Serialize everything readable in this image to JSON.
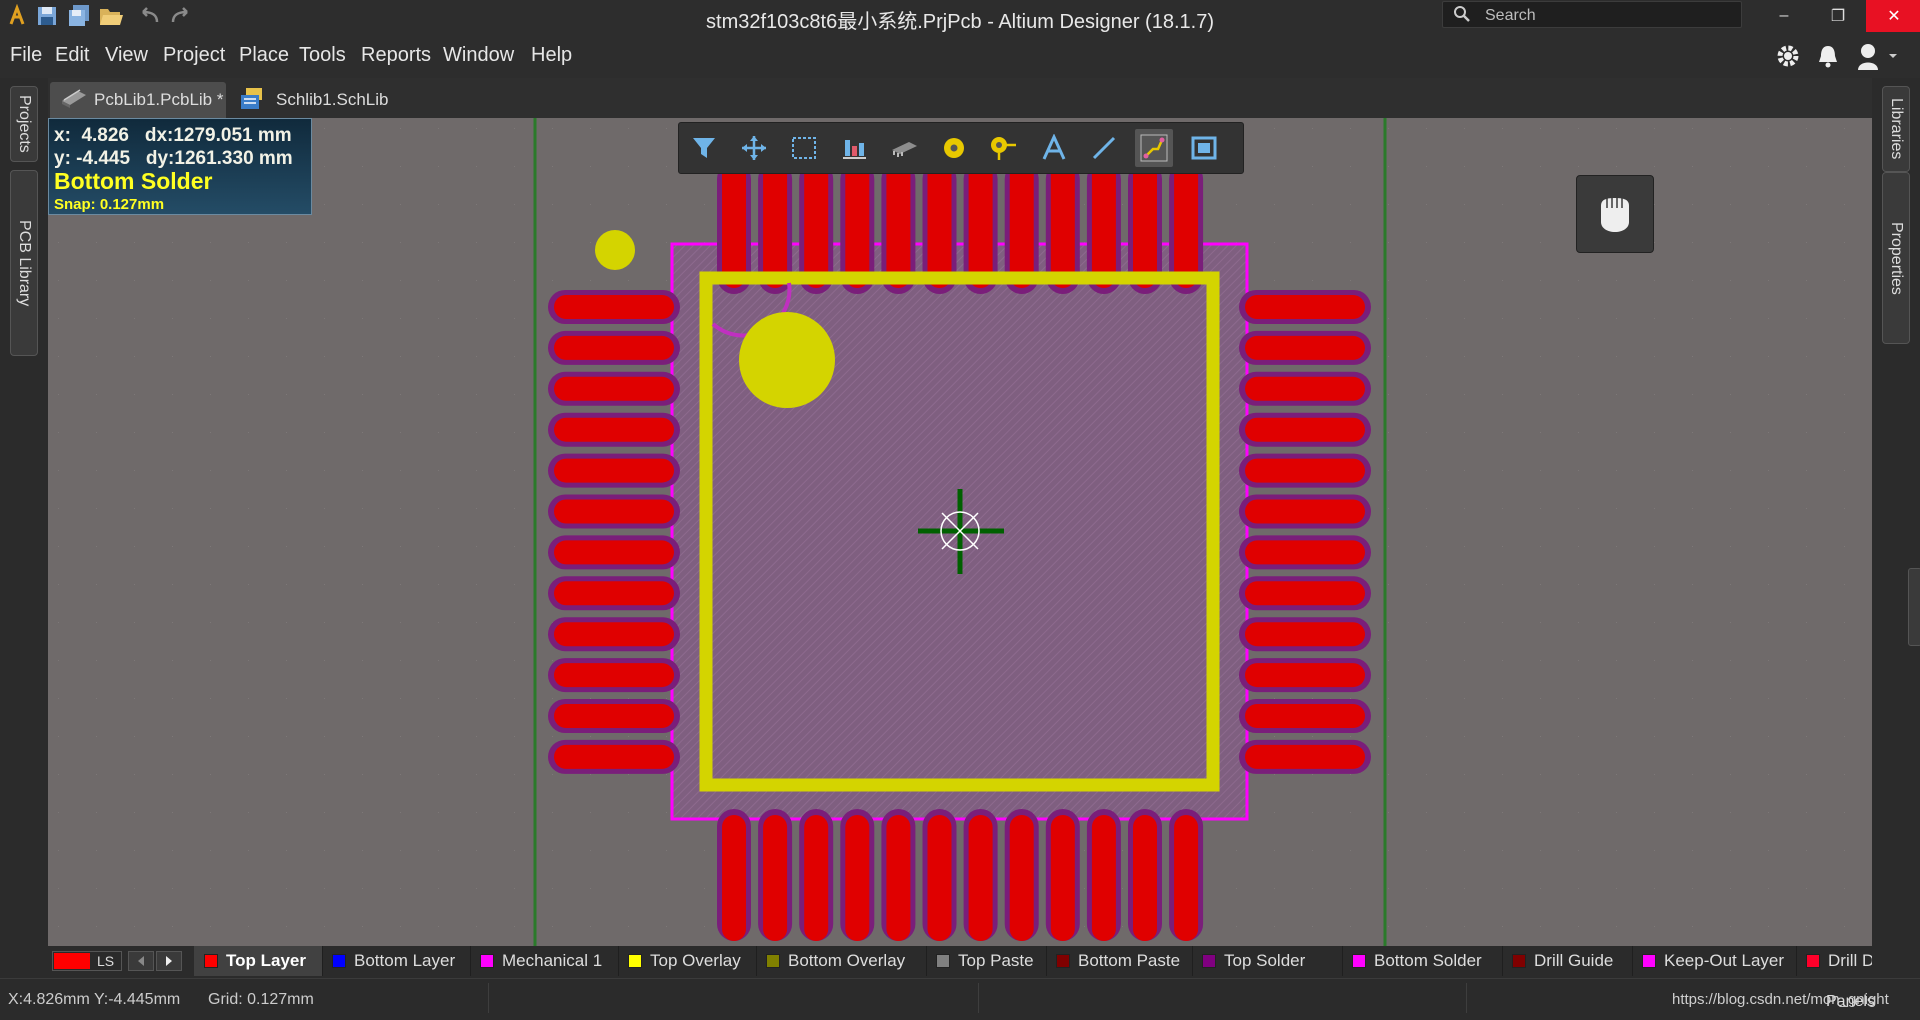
{
  "window": {
    "title": "stm32f103c8t6最小系统.PrjPcb - Altium Designer (18.1.7)",
    "search_placeholder": "Search",
    "min_glyph": "–",
    "restore_glyph": "❐",
    "close_glyph": "✕"
  },
  "menu": {
    "items": [
      "File",
      "Edit",
      "View",
      "Project",
      "Place",
      "Tools",
      "Reports",
      "Window",
      "Help"
    ]
  },
  "tabs": {
    "items": [
      {
        "label": "PcbLib1.PcbLib *",
        "active": true
      },
      {
        "label": "Schlib1.SchLib",
        "active": false
      }
    ]
  },
  "left_panels": [
    "Projects",
    "PCB Library"
  ],
  "right_panels": [
    "Libraries",
    "Properties"
  ],
  "hud": {
    "x_line": "x:  4.826   dx:1279.051 mm",
    "y_line": "y: -4.445   dy:1261.330 mm",
    "layer": "Bottom Solder",
    "snap": "Snap: 0.127mm"
  },
  "placement_toolbar": [
    "filter-icon",
    "move-icon",
    "select-rect-icon",
    "align-icon",
    "component-icon",
    "pad-icon",
    "via-icon",
    "string-icon",
    "line-icon",
    "route-icon",
    "region-icon"
  ],
  "layer_bar": {
    "ls_label": "LS",
    "current_color": "#ff0000",
    "layers": [
      {
        "name": "Top Layer",
        "color": "#ff0000",
        "active": true
      },
      {
        "name": "Bottom Layer",
        "color": "#0000ff",
        "active": false
      },
      {
        "name": "Mechanical 1",
        "color": "#ff00ff",
        "active": false
      },
      {
        "name": "Top Overlay",
        "color": "#ffff00",
        "active": false
      },
      {
        "name": "Bottom Overlay",
        "color": "#808000",
        "active": false
      },
      {
        "name": "Top Paste",
        "color": "#808080",
        "active": false
      },
      {
        "name": "Bottom Paste",
        "color": "#800000",
        "active": false
      },
      {
        "name": "Top Solder",
        "color": "#800080",
        "active": false
      },
      {
        "name": "Bottom Solder",
        "color": "#ff00ff",
        "active": false
      },
      {
        "name": "Drill Guide",
        "color": "#800000",
        "active": false
      },
      {
        "name": "Keep-Out Layer",
        "color": "#ff00ff",
        "active": false
      },
      {
        "name": "Drill Draw",
        "color": "#ff002a",
        "active": false
      }
    ]
  },
  "status": {
    "coords": "X:4.826mm Y:-4.445mm",
    "grid": "Grid: 0.127mm",
    "panels": "Panels",
    "watermark": "https://blog.csdn.net/mon_gnight"
  },
  "colors": {
    "pad": "#e00000",
    "pad_mask": "#7a1e7a",
    "overlay": "#d4d400",
    "keepout": "#ff00ff",
    "courtyard": "#c030c0",
    "canvas": "#6f6a6a",
    "guide": "#2a7a2a"
  }
}
